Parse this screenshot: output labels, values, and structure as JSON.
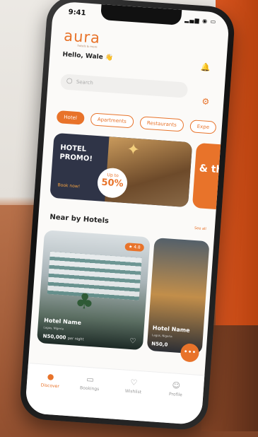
{
  "status": {
    "time": "9:41",
    "icons": "▂▄▆ ◉ ▭"
  },
  "app": {
    "logo": "aura",
    "logo_sub": "hotels & more"
  },
  "header": {
    "greeting": "Hello, Wale 👋"
  },
  "search": {
    "placeholder": "Search"
  },
  "chips": [
    {
      "label": "Hotel",
      "active": true
    },
    {
      "label": "Apartments",
      "active": false
    },
    {
      "label": "Restaurants",
      "active": false
    },
    {
      "label": "Expe",
      "active": false
    }
  ],
  "promo": {
    "title": "HOTEL PROMO!",
    "book": "Book now!",
    "badge_up": "Up to",
    "badge_pct": "50%"
  },
  "promo2": {
    "text": "& th"
  },
  "nearby": {
    "title": "Near by Hotels",
    "see_all": "See all"
  },
  "cards": [
    {
      "rating": "★ 4.8",
      "name": "Hotel Name",
      "location": "Lagos, Nigeria",
      "price": "N50,000",
      "unit": "per night"
    },
    {
      "name": "Hotel Name",
      "location": "Lagos, Nigeria",
      "price": "N50,0"
    }
  ],
  "tabs": [
    {
      "label": "Discover"
    },
    {
      "label": "Bookings"
    },
    {
      "label": "Wishlist"
    },
    {
      "label": "Profile"
    }
  ],
  "colors": {
    "accent": "#e8732a",
    "promo_bg": "#2f3447"
  }
}
